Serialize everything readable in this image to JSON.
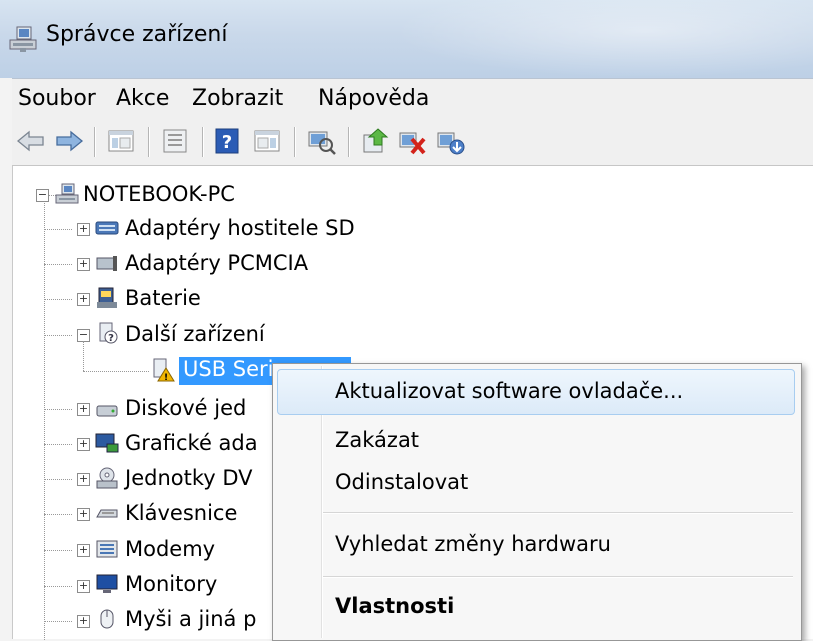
{
  "window": {
    "title": "Správce zařízení",
    "icon": "device-manager-icon"
  },
  "menu": [
    "Soubor",
    "Akce",
    "Zobrazit",
    "Nápověda"
  ],
  "toolbar": {
    "buttons": [
      "back-arrow-icon",
      "forward-arrow-icon",
      "show-hide-tree-icon",
      "properties-icon",
      "help-icon",
      "action-pane-icon",
      "scan-hardware-icon",
      "update-driver-icon",
      "uninstall-icon",
      "enable-icon"
    ]
  },
  "tree": {
    "root": "NOTEBOOK-PC",
    "items": [
      {
        "label": "Adaptéry hostitele SD",
        "icon": "sd-host-adapter-icon",
        "state": "collapsed"
      },
      {
        "label": "Adaptéry PCMCIA",
        "icon": "pcmcia-adapter-icon",
        "state": "collapsed"
      },
      {
        "label": "Baterie",
        "icon": "battery-icon",
        "state": "collapsed"
      },
      {
        "label": "Další zařízení",
        "icon": "other-devices-icon",
        "state": "expanded"
      },
      {
        "label": "USB Seri",
        "icon": "unknown-device-warning-icon",
        "state": "selected-child"
      },
      {
        "label": "Diskové jed",
        "icon": "disk-drive-icon",
        "state": "collapsed"
      },
      {
        "label": "Grafické ada",
        "icon": "display-adapter-icon",
        "state": "collapsed"
      },
      {
        "label": "Jednotky DV",
        "icon": "dvd-drive-icon",
        "state": "collapsed"
      },
      {
        "label": "Klávesnice",
        "icon": "keyboard-icon",
        "state": "collapsed"
      },
      {
        "label": "Modemy",
        "icon": "modem-icon",
        "state": "collapsed"
      },
      {
        "label": "Monitory",
        "icon": "monitor-icon",
        "state": "collapsed"
      },
      {
        "label": "Myši a jiná p",
        "icon": "mouse-icon",
        "state": "collapsed"
      }
    ]
  },
  "context_menu": {
    "items": [
      {
        "label": "Aktualizovat software ovladače...",
        "bold": false,
        "highlighted": true
      },
      {
        "label": "Zakázat",
        "bold": false
      },
      {
        "label": "Odinstalovat",
        "bold": false
      },
      {
        "label": "Vyhledat změny hardwaru",
        "bold": false
      },
      {
        "label": "Vlastnosti",
        "bold": true
      }
    ]
  },
  "colors": {
    "selection": "#3399ff",
    "menu_hover_border": "#a8cdf0",
    "warning": "#f2b600"
  }
}
